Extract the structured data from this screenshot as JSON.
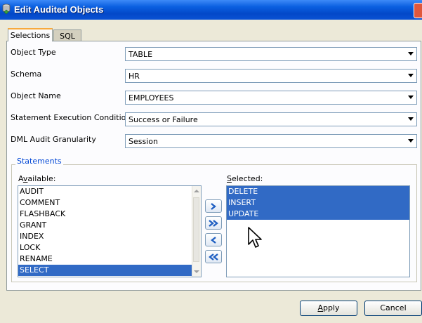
{
  "window": {
    "title": "Edit Audited Objects"
  },
  "tabs": [
    {
      "label": "Selections",
      "active": true
    },
    {
      "label": "SQL",
      "active": false
    }
  ],
  "form": {
    "object_type": {
      "label": "Object Type",
      "value": "TABLE"
    },
    "schema": {
      "label": "Schema",
      "value": "HR"
    },
    "object_name": {
      "label": "Object Name",
      "value": "EMPLOYEES"
    },
    "condition": {
      "label": "Statement Execution Condition",
      "value": "Success or Failure"
    },
    "granularity": {
      "label": "DML Audit Granularity",
      "value": "Session"
    }
  },
  "statements": {
    "group_label": "Statements",
    "available": {
      "label_mnemonic": "v",
      "label_prefix": "A",
      "label_suffix": "ailable:",
      "items": [
        "AUDIT",
        "COMMENT",
        "FLASHBACK",
        "GRANT",
        "INDEX",
        "LOCK",
        "RENAME",
        "SELECT"
      ],
      "selected_item": "SELECT"
    },
    "selected": {
      "label_mnemonic": "S",
      "label_suffix": "elected:",
      "items": [
        "DELETE",
        "INSERT",
        "UPDATE"
      ]
    }
  },
  "buttons": {
    "apply_mnemonic": "A",
    "apply_suffix": "pply",
    "cancel": "Cancel"
  },
  "colors": {
    "titlebar": "#0348c8",
    "selection": "#316ac5",
    "group_label": "#0046d5",
    "tab_highlight": "#f7a93c"
  },
  "icons": [
    "database-icon",
    "close-icon",
    "move-right-icon",
    "move-all-right-icon",
    "move-left-icon",
    "move-all-left-icon",
    "mouse-cursor-icon"
  ]
}
